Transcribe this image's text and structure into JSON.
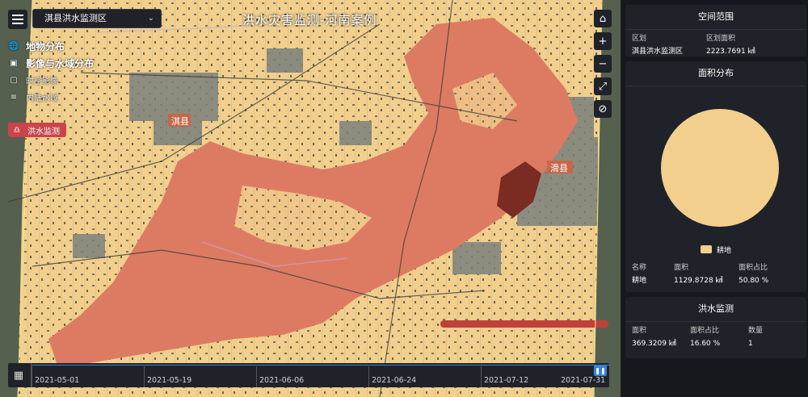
{
  "map": {
    "title": "洪水灾害监测-河南案例",
    "region_select": "淇县洪水监测区",
    "layers": [
      {
        "label": "地物分布",
        "icon": "globe-icon",
        "style": "bold"
      },
      {
        "label": "影像与水域分布",
        "icon": "image-icon",
        "style": "bold"
      },
      {
        "label": "时空影像",
        "icon": "photo-frame-icon",
        "style": "dim"
      },
      {
        "label": "内陆水域",
        "icon": "list-icon",
        "style": "dim"
      }
    ],
    "flood_tag": "洪水监测",
    "labels": {
      "qixian": "淇县",
      "huaxian": "滑县"
    },
    "colors": {
      "farmland": "#f2cf8c",
      "flood": "#dd7b62",
      "urban": "#8a8f8a"
    }
  },
  "tools": [
    "home-icon",
    "zoom-in-icon",
    "zoom-out-icon",
    "fullscreen-icon",
    "eye-slash-icon"
  ],
  "timeline": {
    "dates": [
      "2021-05-01",
      "2021-05-19",
      "2021-06-06",
      "2021-06-24",
      "2021-07-12",
      "2021-07-31"
    ]
  },
  "spatial": {
    "title": "空间范围",
    "headers": [
      "区划",
      "区划面积"
    ],
    "row": [
      "淇县洪水监测区",
      "2223.7691 ㎢"
    ]
  },
  "area": {
    "title": "面积分布",
    "chart_data": {
      "type": "pie",
      "categories": [
        "耕地"
      ],
      "values": [
        100
      ],
      "colors": [
        "#f2cf8c"
      ]
    },
    "legend": "耕地",
    "headers": [
      "名称",
      "面积",
      "面积占比"
    ],
    "row": [
      "耕地",
      "1129.8728 ㎢",
      "50.80 %"
    ]
  },
  "flood": {
    "title": "洪水监测",
    "headers": [
      "面积",
      "面积占比",
      "数量"
    ],
    "row": [
      "369.3209 ㎢",
      "16.60 %",
      "1"
    ]
  }
}
